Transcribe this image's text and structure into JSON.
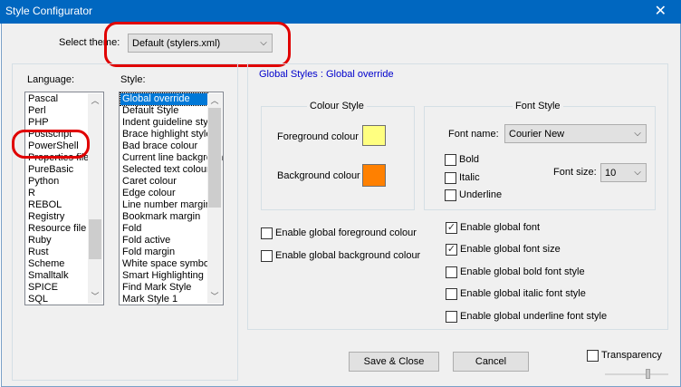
{
  "window": {
    "title": "Style Configurator"
  },
  "theme": {
    "label": "Select theme:",
    "value": "Default (stylers.xml)"
  },
  "language": {
    "label": "Language:",
    "items": [
      "Pascal",
      "Perl",
      "PHP",
      "Postscript",
      "PowerShell",
      "Properties file",
      "PureBasic",
      "Python",
      "R",
      "REBOL",
      "Registry",
      "Resource file",
      "Ruby",
      "Rust",
      "Scheme",
      "Smalltalk",
      "SPICE",
      "SQL"
    ]
  },
  "style": {
    "label": "Style:",
    "items": [
      "Global override",
      "Default Style",
      "Indent guideline style",
      "Brace highlight style",
      "Bad brace colour",
      "Current line background colour",
      "Selected text colour",
      "Caret colour",
      "Edge colour",
      "Line number margin",
      "Bookmark margin",
      "Fold",
      "Fold active",
      "Fold margin",
      "White space symbol",
      "Smart Highlighting",
      "Find Mark Style",
      "Mark Style 1"
    ]
  },
  "heading": "Global Styles : Global override",
  "colour_style": {
    "caption": "Colour Style",
    "foreground_label": "Foreground colour",
    "background_label": "Background colour",
    "foreground_color": "#ffff80",
    "background_color": "#ff8000"
  },
  "font_style": {
    "caption": "Font Style",
    "font_name_label": "Font name:",
    "font_name_value": "Courier New",
    "bold_label": "Bold",
    "italic_label": "Italic",
    "underline_label": "Underline",
    "font_size_label": "Font size:",
    "font_size_value": "10"
  },
  "options": {
    "global_fg": "Enable global foreground colour",
    "global_bg": "Enable global background colour",
    "global_font": "Enable global font",
    "global_font_size": "Enable global font size",
    "global_bold": "Enable global bold font style",
    "global_italic": "Enable global italic font style",
    "global_underline": "Enable global underline font style"
  },
  "checks": {
    "global_fg": false,
    "global_bg": false,
    "global_font": true,
    "global_font_size": true,
    "global_bold": false,
    "global_italic": false,
    "global_underline": false,
    "bold": false,
    "italic": false,
    "underline": false,
    "transparency": false
  },
  "buttons": {
    "save_close": "Save & Close",
    "cancel": "Cancel"
  },
  "transparency_label": "Transparency",
  "icons": {
    "close": "close-icon",
    "dropdown": "chevron-down-icon",
    "check": "checkmark-icon"
  },
  "annotation_color": "#e00000"
}
